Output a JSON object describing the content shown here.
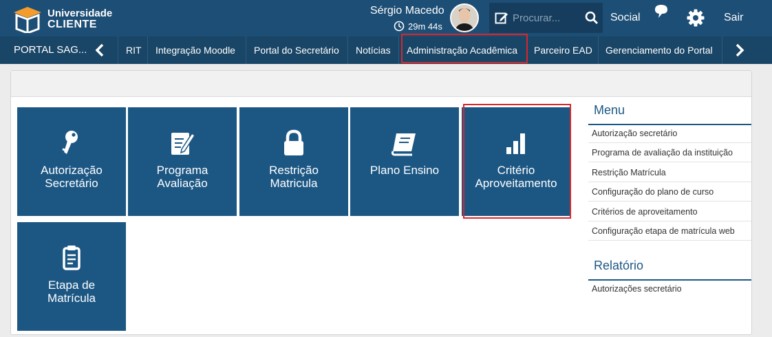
{
  "brand": {
    "line1": "Universidade",
    "line2": "CLIENTE"
  },
  "user": {
    "name": "Sérgio Macedo",
    "timer": "29m 44s"
  },
  "search": {
    "placeholder": "Procurar..."
  },
  "topnav": {
    "social": "Social",
    "logout": "Sair"
  },
  "navbar": {
    "portal": "PORTAL SAG...",
    "items": [
      "RIT",
      "Integração Moodle",
      "Portal do Secretário",
      "Notícias",
      "Administração Acadêmica",
      "Parceiro EAD",
      "Gerenciamento do Portal"
    ]
  },
  "tiles": [
    {
      "line1": "Autorização",
      "line2": "Secretário",
      "icon": "key-icon"
    },
    {
      "line1": "Programa",
      "line2": "Avaliação",
      "icon": "edit-document-icon"
    },
    {
      "line1": "Restrição",
      "line2": "Matricula",
      "icon": "lock-icon"
    },
    {
      "line1": "Plano Ensino",
      "line2": "",
      "icon": "book-icon"
    },
    {
      "line1": "Critério",
      "line2": "Aproveitamento",
      "icon": "bar-chart-icon"
    },
    {
      "line1": "Etapa de",
      "line2": "Matrícula",
      "icon": "clipboard-icon"
    }
  ],
  "side_menu": {
    "title": "Menu",
    "items": [
      "Autorização secretário",
      "Programa de avaliação da instituição",
      "Restrição Matrícula",
      "Configuração do plano de curso",
      "Critérios de aproveitamento",
      "Configuração etapa de matrícula web"
    ]
  },
  "side_report": {
    "title": "Relatório",
    "items": [
      "Autorizações secretário"
    ]
  },
  "colors": {
    "topbar": "#1d4e75",
    "navbar": "#194566",
    "tile": "#1c5784",
    "highlight": "#d9262c"
  }
}
